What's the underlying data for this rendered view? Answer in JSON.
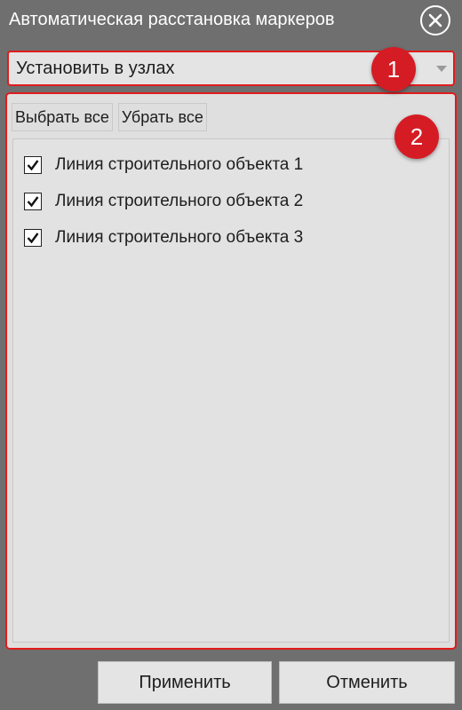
{
  "window": {
    "title": "Автоматическая расстановка маркеров",
    "close_icon": "close-icon"
  },
  "mode_select": {
    "selected": "Установить в узлах",
    "arrow_icon": "chevron-down-icon"
  },
  "annotations": {
    "badge_1": "1",
    "badge_2": "2",
    "highlight_color": "#e21b1b",
    "badge_color": "#d51c24"
  },
  "list_toolbar": {
    "select_all": "Выбрать все",
    "deselect_all": "Убрать все"
  },
  "items": [
    {
      "label": "Линия строительного объекта 1",
      "checked": true
    },
    {
      "label": "Линия строительного объекта 2",
      "checked": true
    },
    {
      "label": "Линия строительного объекта 3",
      "checked": true
    }
  ],
  "footer": {
    "apply": "Применить",
    "cancel": "Отменить"
  }
}
